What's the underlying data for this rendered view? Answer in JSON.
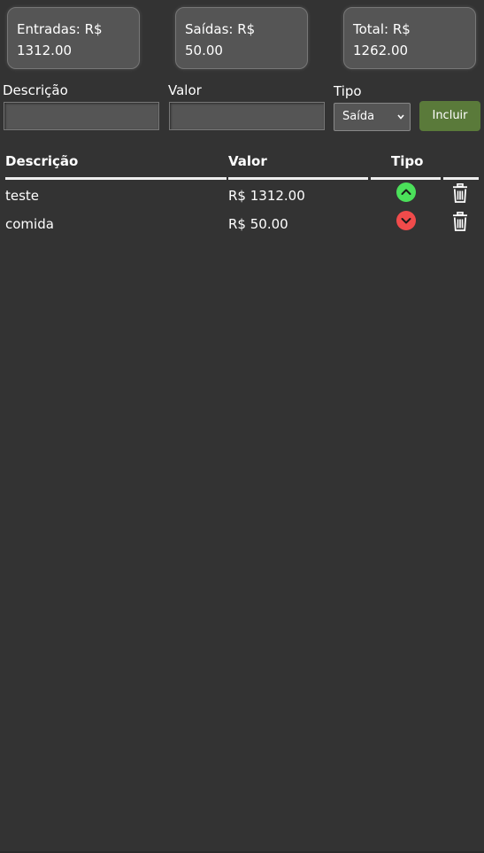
{
  "summary": {
    "entradas": {
      "label": "Entradas: R$",
      "value": "1312.00"
    },
    "saidas": {
      "label": "Saídas: R$",
      "value": "50.00"
    },
    "total": {
      "label": "Total: R$",
      "value": "1262.00"
    }
  },
  "form": {
    "descricao_label": "Descrição",
    "descricao_value": "",
    "valor_label": "Valor",
    "valor_value": "",
    "tipo_label": "Tipo",
    "tipo_selected": "Saída",
    "submit_label": "Incluir"
  },
  "table": {
    "headers": [
      "Descrição",
      "Valor",
      "Tipo",
      ""
    ],
    "rows": [
      {
        "descricao": "teste",
        "valor": "R$ 1312.00",
        "tipo": "entrada",
        "tipo_icon": "arrow-up-circle-icon"
      },
      {
        "descricao": "comida",
        "valor": "R$ 50.00",
        "tipo": "saida",
        "tipo_icon": "arrow-down-circle-icon"
      }
    ]
  },
  "colors": {
    "background": "#333333",
    "card": "#555555",
    "button": "#5a7a3a",
    "income": "#4be05a",
    "expense": "#f04b4b"
  }
}
